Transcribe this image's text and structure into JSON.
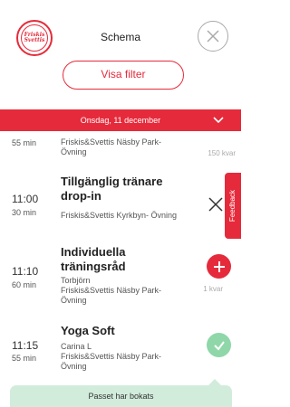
{
  "header": {
    "logo_text": "Friskis Svettis",
    "title": "Schema",
    "filter_label": "Visa filter"
  },
  "date_bar": {
    "date": "Onsdag, 11 december"
  },
  "feedback": {
    "label": "Feedback"
  },
  "sessions": [
    {
      "duration": "55 min",
      "subtitle": "Friskis&Svettis Näsby Park-\nÖvning",
      "spots": "150 kvar"
    },
    {
      "time": "11:00",
      "duration": "30 min",
      "name": "Tillgänglig tränare\ndrop-in",
      "subtitle": "Friskis&Svettis Kyrkbyn- Övning"
    },
    {
      "time": "11:10",
      "duration": "60 min",
      "name": "Individuella\nträningsråd",
      "trainer": "Torbjörn",
      "subtitle": "Friskis&Svettis Näsby Park-\nÖvning",
      "spots": "1 kvar"
    },
    {
      "time": "11:15",
      "duration": "55 min",
      "name": "Yoga Soft",
      "trainer": "Carina L",
      "subtitle": "Friskis&Svettis Näsby Park-\nÖvning"
    }
  ],
  "toast": {
    "message": "Passet har bokats"
  },
  "colors": {
    "accent": "#e52b3b",
    "booked": "#8fd7a9",
    "toast_bg": "#d2ecdc"
  }
}
